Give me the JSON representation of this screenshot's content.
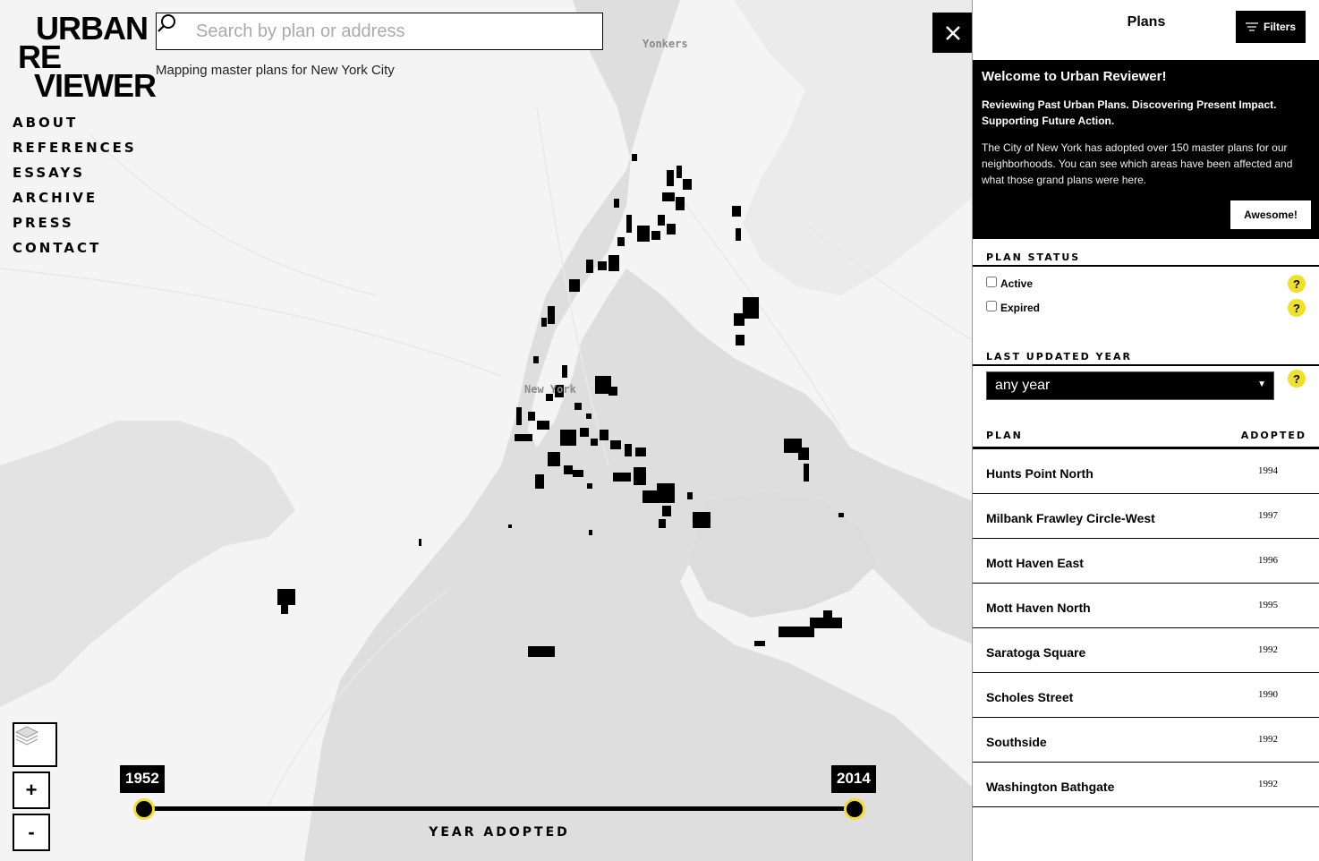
{
  "app": {
    "logo": {
      "line1": "URBAN",
      "line2": "RE",
      "line3": "VIEWER"
    },
    "tagline": "Mapping master plans for New York City"
  },
  "nav": {
    "items": [
      {
        "label": "ABOUT"
      },
      {
        "label": "REFERENCES"
      },
      {
        "label": "ESSAYS"
      },
      {
        "label": "ARCHIVE"
      },
      {
        "label": "PRESS"
      },
      {
        "label": "CONTACT"
      }
    ]
  },
  "search": {
    "placeholder": "Search by plan or address",
    "value": "",
    "icon": "search-icon"
  },
  "map": {
    "labels": {
      "yonkers": "Yonkers",
      "new_york": "New York"
    },
    "controls": {
      "layers_icon": "layers-icon",
      "zoom_in": "+",
      "zoom_out": "-"
    },
    "close_icon": "close-icon"
  },
  "timeline": {
    "start_year": "1952",
    "end_year": "2014",
    "title": "YEAR ADOPTED",
    "accent": "#f0e02a"
  },
  "sidebar": {
    "title": "Plans",
    "filters_label": "Filters",
    "welcome": {
      "title": "Welcome to Urban Reviewer!",
      "subtitle": "Reviewing Past Urban Plans. Discovering Present Impact. Supporting Future Action.",
      "body": "The City of New York has adopted over 150 master plans for our neighborhoods. You can see which areas have been affected and what those grand plans were here.",
      "button": "Awesome!"
    },
    "plan_status": {
      "heading": "PLAN STATUS",
      "options": [
        {
          "label": "Active",
          "checked": false
        },
        {
          "label": "Expired",
          "checked": false
        }
      ]
    },
    "last_updated": {
      "heading": "LAST UPDATED YEAR",
      "selected": "any year"
    },
    "help_label": "?",
    "table": {
      "col_plan": "PLAN",
      "col_adopted": "ADOPTED",
      "rows": [
        {
          "name": "Hunts Point North",
          "year": "1994"
        },
        {
          "name": "Milbank Frawley Circle-West",
          "year": "1997"
        },
        {
          "name": "Mott Haven East",
          "year": "1996"
        },
        {
          "name": "Mott Haven North",
          "year": "1995"
        },
        {
          "name": "Saratoga Square",
          "year": "1992"
        },
        {
          "name": "Scholes Street",
          "year": "1990"
        },
        {
          "name": "Southside",
          "year": "1992"
        },
        {
          "name": "Washington Bathgate",
          "year": "1992"
        }
      ]
    }
  }
}
